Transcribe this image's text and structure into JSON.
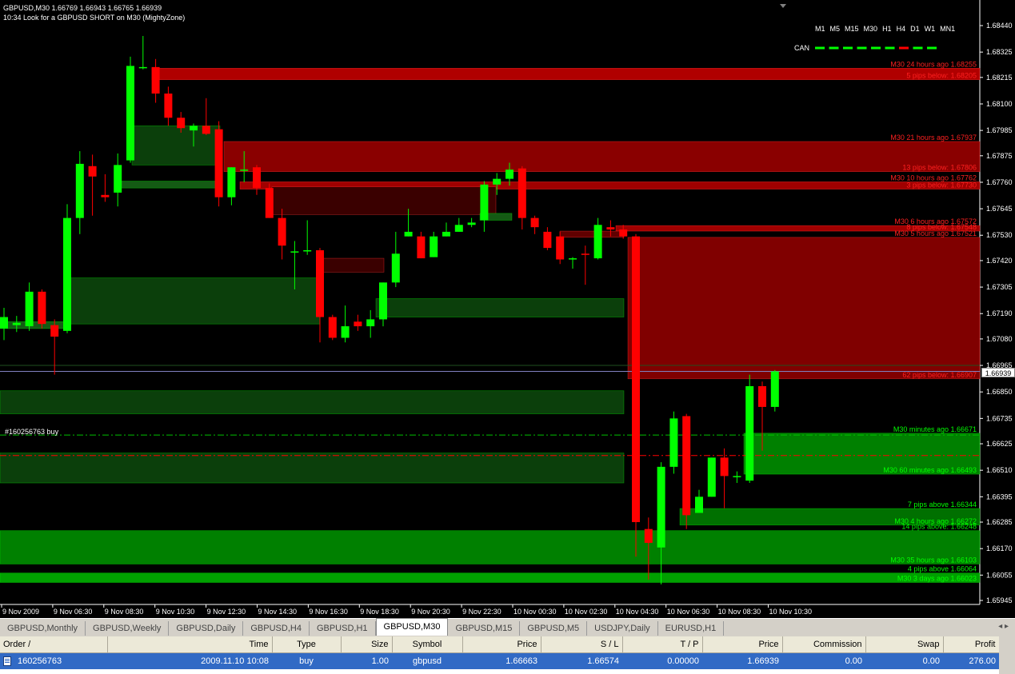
{
  "chart": {
    "header_line1": "GBPUSD,M30  1.66769 1.66943 1.66765 1.66939",
    "header_line2": "10:34 Look for a GBPUSD SHORT on M30 (MightyZone)",
    "timeframes": [
      "M1",
      "M5",
      "M15",
      "M30",
      "H1",
      "H4",
      "D1",
      "W1",
      "MN1"
    ],
    "can_label": "CAN",
    "can_dash_colors": [
      "#00ff00",
      "#00ff00",
      "#00ff00",
      "#00ff00",
      "#00ff00",
      "#00ff00",
      "#ff0000",
      "#00ff00",
      "#00ff00"
    ],
    "order_line_label": "#160256763 buy",
    "current_price": "1.66939",
    "price_axis": {
      "min": 1.65945,
      "max": 1.6844,
      "labels": [
        "1.68440",
        "1.68325",
        "1.68215",
        "1.68100",
        "1.67985",
        "1.67875",
        "1.67760",
        "1.67645",
        "1.67530",
        "1.67420",
        "1.67305",
        "1.67190",
        "1.67080",
        "1.66965",
        "1.66850",
        "1.66735",
        "1.66625",
        "1.66510",
        "1.66395",
        "1.66285",
        "1.66170",
        "1.66055",
        "1.65945"
      ]
    },
    "time_labels": [
      "9 Nov 2009",
      "9 Nov 06:30",
      "9 Nov 08:30",
      "9 Nov 10:30",
      "9 Nov 12:30",
      "9 Nov 14:30",
      "9 Nov 16:30",
      "9 Nov 18:30",
      "9 Nov 20:30",
      "9 Nov 22:30",
      "10 Nov 00:30",
      "10 Nov 02:30",
      "10 Nov 04:30",
      "10 Nov 06:30",
      "10 Nov 08:30",
      "10 Nov 10:30"
    ],
    "colors": {
      "bull": "#00ff00",
      "bear": "#ff0000",
      "zone_red": "#800000",
      "zone_green": "#006400",
      "label_red": "#ff2020",
      "label_green": "#00ff00"
    },
    "zone_labels_red": [
      {
        "text": "M30 24 hours ago 1.68255",
        "price": 1.68255
      },
      {
        "text": "5 pips below: 1.68205",
        "price": 1.68205
      },
      {
        "text": "M30 21 hours ago 1.67937",
        "price": 1.67937
      },
      {
        "text": "13 pips below: 1.67806",
        "price": 1.67806
      },
      {
        "text": "M30 10 hours ago 1.67762",
        "price": 1.67762
      },
      {
        "text": "3 pips below: 1.67730",
        "price": 1.6773
      },
      {
        "text": "M30 6 hours ago 1.67572",
        "price": 1.67572
      },
      {
        "text": "8 pips below: 1.67548",
        "price": 1.67548
      },
      {
        "text": "M30 5 hours ago 1.67521",
        "price": 1.67521
      },
      {
        "text": "62 pips below: 1.66907",
        "price": 1.66907
      }
    ],
    "zone_labels_green": [
      {
        "text": "M30 minutes ago 1.66671",
        "price": 1.66671
      },
      {
        "text": "M30 60 minutes ago 1.66493",
        "price": 1.66493
      },
      {
        "text": "7 pips above 1.66344",
        "price": 1.66344
      },
      {
        "text": "M30 4 hours ago 1.66272",
        "price": 1.66272
      },
      {
        "text": "14 pips above: 1.66248",
        "price": 1.66248
      },
      {
        "text": "M30 35 hours ago 1.66103",
        "price": 1.66103
      },
      {
        "text": "4 pips above 1.66064",
        "price": 1.66064
      },
      {
        "text": "M30 3 days ago 1.66023",
        "price": 1.66023
      }
    ],
    "candles": [
      {
        "o": 1.67125,
        "h": 1.67215,
        "l": 1.67075,
        "c": 1.67175
      },
      {
        "o": 1.6714,
        "h": 1.6718,
        "l": 1.6711,
        "c": 1.6715
      },
      {
        "o": 1.67135,
        "h": 1.67325,
        "l": 1.67115,
        "c": 1.67285
      },
      {
        "o": 1.67285,
        "h": 1.67295,
        "l": 1.67125,
        "c": 1.67145
      },
      {
        "o": 1.6714,
        "h": 1.67165,
        "l": 1.66925,
        "c": 1.6709
      },
      {
        "o": 1.67115,
        "h": 1.67665,
        "l": 1.67105,
        "c": 1.67605
      },
      {
        "o": 1.67605,
        "h": 1.67895,
        "l": 1.67535,
        "c": 1.6784
      },
      {
        "o": 1.6783,
        "h": 1.6788,
        "l": 1.67615,
        "c": 1.67785
      },
      {
        "o": 1.67705,
        "h": 1.67795,
        "l": 1.67675,
        "c": 1.67695
      },
      {
        "o": 1.67715,
        "h": 1.67885,
        "l": 1.67655,
        "c": 1.67835
      },
      {
        "o": 1.67855,
        "h": 1.68305,
        "l": 1.67845,
        "c": 1.68265
      },
      {
        "o": 1.68255,
        "h": 1.68395,
        "l": 1.6825,
        "c": 1.6826
      },
      {
        "o": 1.6826,
        "h": 1.68295,
        "l": 1.68105,
        "c": 1.68145
      },
      {
        "o": 1.68145,
        "h": 1.68175,
        "l": 1.68005,
        "c": 1.6804
      },
      {
        "o": 1.6804,
        "h": 1.68065,
        "l": 1.67975,
        "c": 1.67995
      },
      {
        "o": 1.67985,
        "h": 1.68015,
        "l": 1.67915,
        "c": 1.68005
      },
      {
        "o": 1.68005,
        "h": 1.68125,
        "l": 1.67965,
        "c": 1.6797
      },
      {
        "o": 1.6799,
        "h": 1.68025,
        "l": 1.67655,
        "c": 1.67695
      },
      {
        "o": 1.67695,
        "h": 1.67825,
        "l": 1.6766,
        "c": 1.67825
      },
      {
        "o": 1.67815,
        "h": 1.67895,
        "l": 1.6776,
        "c": 1.67815
      },
      {
        "o": 1.67825,
        "h": 1.67835,
        "l": 1.67705,
        "c": 1.67735
      },
      {
        "o": 1.67735,
        "h": 1.67755,
        "l": 1.67605,
        "c": 1.67605
      },
      {
        "o": 1.67605,
        "h": 1.67645,
        "l": 1.67425,
        "c": 1.67485
      },
      {
        "o": 1.6746,
        "h": 1.67505,
        "l": 1.67295,
        "c": 1.6746
      },
      {
        "o": 1.6746,
        "h": 1.67595,
        "l": 1.67445,
        "c": 1.67465
      },
      {
        "o": 1.67465,
        "h": 1.67475,
        "l": 1.67065,
        "c": 1.67175
      },
      {
        "o": 1.67175,
        "h": 1.67185,
        "l": 1.67075,
        "c": 1.67085
      },
      {
        "o": 1.67085,
        "h": 1.67225,
        "l": 1.67065,
        "c": 1.67135
      },
      {
        "o": 1.67155,
        "h": 1.67185,
        "l": 1.67115,
        "c": 1.67135
      },
      {
        "o": 1.67135,
        "h": 1.67205,
        "l": 1.67085,
        "c": 1.67165
      },
      {
        "o": 1.67165,
        "h": 1.67325,
        "l": 1.67135,
        "c": 1.67325
      },
      {
        "o": 1.67325,
        "h": 1.67545,
        "l": 1.67305,
        "c": 1.6745
      },
      {
        "o": 1.67525,
        "h": 1.67645,
        "l": 1.67525,
        "c": 1.67545
      },
      {
        "o": 1.67525,
        "h": 1.67545,
        "l": 1.6743,
        "c": 1.6743
      },
      {
        "o": 1.67435,
        "h": 1.67545,
        "l": 1.67435,
        "c": 1.67525
      },
      {
        "o": 1.67525,
        "h": 1.67585,
        "l": 1.67525,
        "c": 1.67545
      },
      {
        "o": 1.67545,
        "h": 1.67605,
        "l": 1.67545,
        "c": 1.67575
      },
      {
        "o": 1.67575,
        "h": 1.67605,
        "l": 1.67565,
        "c": 1.67585
      },
      {
        "o": 1.67595,
        "h": 1.67765,
        "l": 1.67545,
        "c": 1.6775
      },
      {
        "o": 1.6775,
        "h": 1.678,
        "l": 1.67705,
        "c": 1.67775
      },
      {
        "o": 1.67775,
        "h": 1.67845,
        "l": 1.67745,
        "c": 1.67815
      },
      {
        "o": 1.6782,
        "h": 1.6783,
        "l": 1.67555,
        "c": 1.67605
      },
      {
        "o": 1.67605,
        "h": 1.67615,
        "l": 1.67535,
        "c": 1.67565
      },
      {
        "o": 1.67545,
        "h": 1.67565,
        "l": 1.67465,
        "c": 1.67475
      },
      {
        "o": 1.67525,
        "h": 1.67545,
        "l": 1.67405,
        "c": 1.67425
      },
      {
        "o": 1.67425,
        "h": 1.67435,
        "l": 1.67385,
        "c": 1.6743
      },
      {
        "o": 1.6745,
        "h": 1.67485,
        "l": 1.67315,
        "c": 1.67445
      },
      {
        "o": 1.6743,
        "h": 1.67605,
        "l": 1.67425,
        "c": 1.67575
      },
      {
        "o": 1.67565,
        "h": 1.67595,
        "l": 1.67525,
        "c": 1.67555
      },
      {
        "o": 1.67555,
        "h": 1.67575,
        "l": 1.67515,
        "c": 1.67525
      },
      {
        "o": 1.67525,
        "h": 1.67535,
        "l": 1.66135,
        "c": 1.66285
      },
      {
        "o": 1.66255,
        "h": 1.66305,
        "l": 1.66035,
        "c": 1.66195
      },
      {
        "o": 1.66175,
        "h": 1.66545,
        "l": 1.66015,
        "c": 1.66525
      },
      {
        "o": 1.66525,
        "h": 1.66765,
        "l": 1.66495,
        "c": 1.66735
      },
      {
        "o": 1.66745,
        "h": 1.66755,
        "l": 1.66255,
        "c": 1.66315
      },
      {
        "o": 1.66325,
        "h": 1.66425,
        "l": 1.66325,
        "c": 1.66395
      },
      {
        "o": 1.66395,
        "h": 1.66565,
        "l": 1.66395,
        "c": 1.66565
      },
      {
        "o": 1.66565,
        "h": 1.66605,
        "l": 1.66345,
        "c": 1.66485
      },
      {
        "o": 1.66485,
        "h": 1.66505,
        "l": 1.66455,
        "c": 1.66485
      },
      {
        "o": 1.66465,
        "h": 1.66925,
        "l": 1.66455,
        "c": 1.66875
      },
      {
        "o": 1.66875,
        "h": 1.66895,
        "l": 1.66595,
        "c": 1.66785
      },
      {
        "o": 1.66785,
        "h": 1.66945,
        "l": 1.66765,
        "c": 1.66939
      }
    ]
  },
  "tabs": [
    {
      "label": "GBPUSD,Monthly",
      "active": false
    },
    {
      "label": "GBPUSD,Weekly",
      "active": false
    },
    {
      "label": "GBPUSD,Daily",
      "active": false
    },
    {
      "label": "GBPUSD,H4",
      "active": false
    },
    {
      "label": "GBPUSD,H1",
      "active": false
    },
    {
      "label": "GBPUSD,M30",
      "active": true
    },
    {
      "label": "GBPUSD,M15",
      "active": false
    },
    {
      "label": "GBPUSD,M5",
      "active": false
    },
    {
      "label": "USDJPY,Daily",
      "active": false
    },
    {
      "label": "EURUSD,H1",
      "active": false
    }
  ],
  "tab_scroll": "◂ ▸",
  "terminal": {
    "columns": [
      "Order  /",
      "Time",
      "Type",
      "Size",
      "Symbol",
      "Price",
      "S / L",
      "T / P",
      "Price",
      "Commission",
      "Swap",
      "Profit"
    ],
    "rows": [
      [
        "160256763",
        "2009.11.10 10:08",
        "buy",
        "1.00",
        "gbpusd",
        "1.66663",
        "1.66574",
        "0.00000",
        "1.66939",
        "0.00",
        "0.00",
        "276.00"
      ]
    ]
  }
}
